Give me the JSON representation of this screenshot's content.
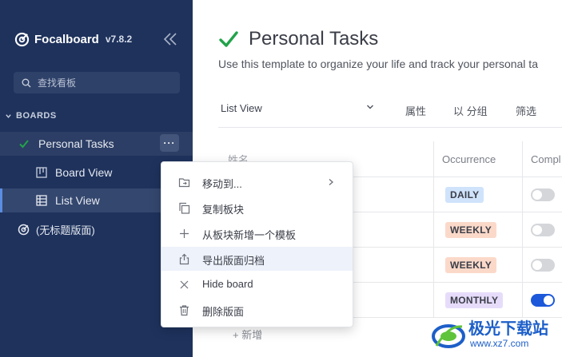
{
  "sidebar": {
    "brand_name": "Focalboard",
    "version": "v7.8.2",
    "search_placeholder": "查找看板",
    "section_label": "BOARDS",
    "items": [
      {
        "label": "Personal Tasks"
      },
      {
        "label": "Board View"
      },
      {
        "label": "List View"
      },
      {
        "label": "(无标题版面)"
      }
    ]
  },
  "board": {
    "title": "Personal Tasks",
    "description": "Use this template to organize your life and track your personal ta"
  },
  "toolbar": {
    "view_name": "List View",
    "properties_label": "属性",
    "group_label": "以 分组",
    "filter_label": "筛选"
  },
  "table": {
    "columns": [
      "姓名",
      "Occurrence",
      "Compl"
    ],
    "rows": [
      {
        "occurrence": "DAILY",
        "color": "#cfe3fb",
        "complete": false
      },
      {
        "occurrence": "WEEKLY",
        "color": "#fbd9c9",
        "complete": false
      },
      {
        "occurrence": "WEEKLY",
        "color": "#fbd9c9",
        "complete": false
      },
      {
        "occurrence": "MONTHLY",
        "color": "#e6dcfa",
        "complete": true
      }
    ],
    "add_label": "+ 新增"
  },
  "context_menu": {
    "items": [
      {
        "label": "移动到...",
        "icon": "folder-move-icon"
      },
      {
        "label": "复制板块",
        "icon": "copy-icon"
      },
      {
        "label": "从板块新增一个模板",
        "icon": "plus-icon"
      },
      {
        "label": "导出版面归档",
        "icon": "export-icon"
      },
      {
        "label": "Hide board",
        "icon": "close-icon"
      },
      {
        "label": "删除版面",
        "icon": "trash-icon"
      }
    ]
  },
  "watermark": {
    "text": "极光下载站",
    "url": "www.xz7.com"
  },
  "colors": {
    "sidebar_bg": "#1e325c",
    "accent": "#1c58d9",
    "check_green": "#22a34a"
  }
}
